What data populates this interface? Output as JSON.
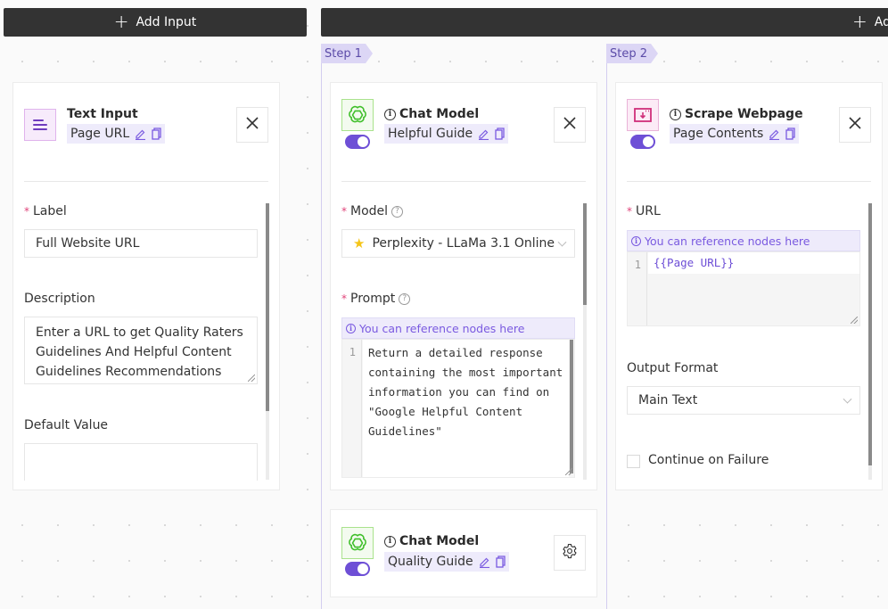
{
  "toolbar": {
    "add_input_label": "Add Input",
    "add_step_label": "Add Step"
  },
  "steps": [
    {
      "label": "Step 1"
    },
    {
      "label": "Step 2"
    }
  ],
  "input_node": {
    "type": "Text Input",
    "name": "Page URL",
    "icon": "text-lines-icon",
    "fields": {
      "label": {
        "title": "Label",
        "required": true,
        "value": "Full Website URL"
      },
      "description": {
        "title": "Description",
        "value": "Enter a URL to get Quality Raters Guidelines And Helpful Content Guidelines Recommendations"
      },
      "default_value": {
        "title": "Default Value",
        "value": ""
      }
    }
  },
  "chat_node_1": {
    "type": "Chat Model",
    "name": "Helpful Guide",
    "enabled": true,
    "icon": "openai-icon",
    "fields": {
      "model": {
        "title": "Model",
        "required": true,
        "value": "Perplexity - LLaMa 3.1 Online",
        "icon": "star-icon"
      },
      "prompt": {
        "title": "Prompt",
        "required": true,
        "hint": "You can reference nodes here",
        "line_number": "1",
        "value": "Return a detailed response containing the most important information you can find on \"Google Helpful Content Guidelines\""
      }
    }
  },
  "chat_node_2": {
    "type": "Chat Model",
    "name": "Quality Guide",
    "enabled": true,
    "icon": "openai-icon"
  },
  "scrape_node": {
    "type": "Scrape Webpage",
    "name": "Page Contents",
    "enabled": true,
    "icon": "scrape-download-icon",
    "fields": {
      "url": {
        "title": "URL",
        "required": true,
        "hint": "You can reference nodes here",
        "line_number": "1",
        "value": "{{Page URL}}"
      },
      "output_format": {
        "title": "Output Format",
        "value": "Main Text"
      },
      "continue_on_failure": {
        "label": "Continue on Failure",
        "checked": false
      }
    }
  },
  "colors": {
    "accent": "#6e4fd6",
    "toolbar_bg": "#333333",
    "required_mark": "#e0447a",
    "chip_bg": "#eeebfb"
  }
}
